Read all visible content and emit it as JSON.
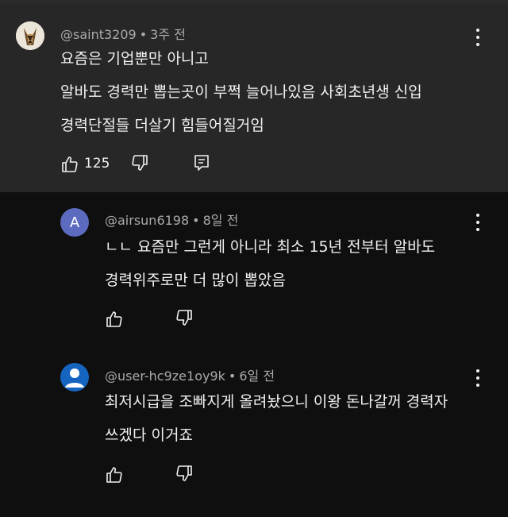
{
  "comments": [
    {
      "author": "@saint3209",
      "time": "3주 전",
      "lines": [
        "요즘은 기업뿐만 아니고",
        "알바도 경력만 뽑는곳이 부쩍 늘어나있음 사회초년생 신입",
        "경력단절들 더살기 힘들어질거임"
      ],
      "likes": "125",
      "avatar_icon": "dog-avatar-icon"
    },
    {
      "author": "@airsun6198",
      "time": "8일 전",
      "lines": [
        "ㄴㄴ 요즘만 그런게 아니라 최소 15년 전부터 알바도",
        "경력위주로만 더 많이 뽑았음"
      ],
      "avatar_letter": "A",
      "avatar_color": "#5c6bc0"
    },
    {
      "author": "@user-hc9ze1oy9k",
      "time": "6일 전",
      "lines": [
        "최저시급을 조빠지게 올려놨으니 이왕 돈나갈꺼 경력자",
        "쓰겠다 이거죠"
      ],
      "avatar_icon": "default-user-avatar-icon",
      "avatar_color": "#1565c0"
    }
  ],
  "separator": "•"
}
